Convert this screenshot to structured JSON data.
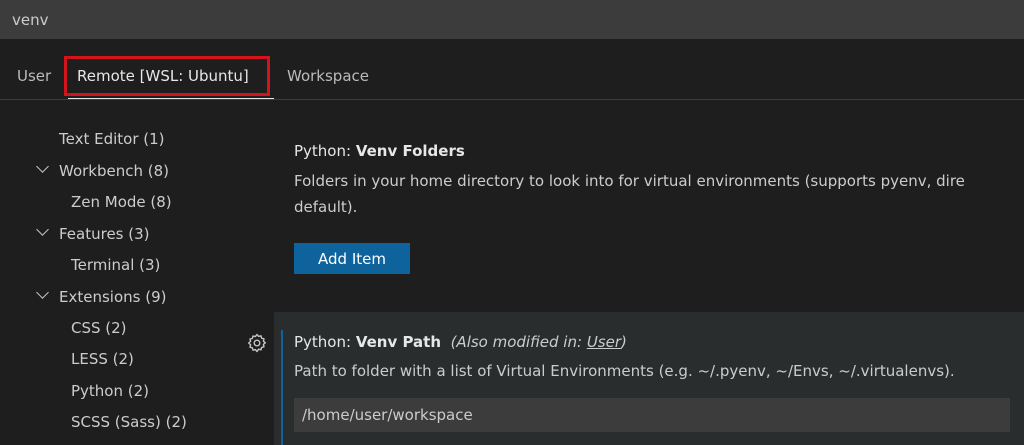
{
  "search": {
    "value": "venv"
  },
  "tabs": [
    {
      "label": "User"
    },
    {
      "label": "Remote [WSL: Ubuntu]",
      "active": true,
      "highlighted": true
    },
    {
      "label": "Workspace"
    }
  ],
  "toc": [
    {
      "label": "Text Editor (1)"
    },
    {
      "label": "Workbench (8)",
      "expanded": true
    },
    {
      "label": "Zen Mode (8)"
    },
    {
      "label": "Features (3)",
      "expanded": true
    },
    {
      "label": "Terminal (3)"
    },
    {
      "label": "Extensions (9)",
      "expanded": true
    },
    {
      "label": "CSS (2)"
    },
    {
      "label": "LESS (2)"
    },
    {
      "label": "Python (2)"
    },
    {
      "label": "SCSS (Sass) (2)"
    }
  ],
  "settings": [
    {
      "category": "Python: ",
      "key": "Venv Folders",
      "description": "Folders in your home directory to look into for virtual environments (supports pyenv, dire default).",
      "button_label": "Add Item"
    },
    {
      "category": "Python: ",
      "key": "Venv Path",
      "modified_prefix": "(Also modified in: ",
      "modified_link": "User",
      "modified_suffix": ")",
      "description": "Path to folder with a list of Virtual Environments (e.g. ~/.pyenv, ~/Envs, ~/.virtualenvs).",
      "value": "/home/user/workspace"
    }
  ],
  "colors": {
    "highlight": "#d4141c",
    "accent": "#0e639c",
    "background": "#1e1e1e"
  },
  "icons": {
    "toc_chevron": "chevron-down-icon",
    "setting_gear": "gear-icon"
  }
}
